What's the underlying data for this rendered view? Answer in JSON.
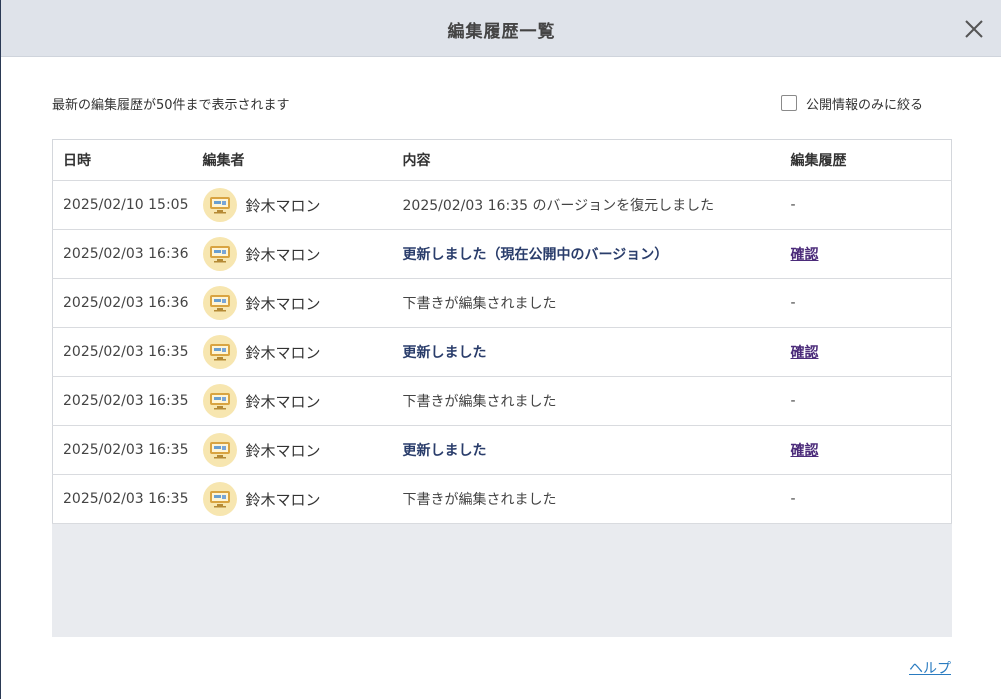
{
  "header": {
    "title": "編集履歴一覧"
  },
  "note": "最新の編集履歴が50件まで表示されます",
  "filter": {
    "label": "公開情報のみに絞る",
    "checked": false
  },
  "table": {
    "columns": [
      "日時",
      "編集者",
      "内容",
      "編集履歴"
    ],
    "rows": [
      {
        "datetime": "2025/02/10 15:05",
        "editor": "鈴木マロン",
        "content": "2025/02/03 16:35 のバージョンを復元しました",
        "history": "-"
      },
      {
        "datetime": "2025/02/03 16:36",
        "editor": "鈴木マロン",
        "content": "更新しました（現在公開中のバージョン）",
        "history": "確認"
      },
      {
        "datetime": "2025/02/03 16:36",
        "editor": "鈴木マロン",
        "content": "下書きが編集されました",
        "history": "-"
      },
      {
        "datetime": "2025/02/03 16:35",
        "editor": "鈴木マロン",
        "content": "更新しました",
        "history": "確認"
      },
      {
        "datetime": "2025/02/03 16:35",
        "editor": "鈴木マロン",
        "content": "下書きが編集されました",
        "history": "-"
      },
      {
        "datetime": "2025/02/03 16:35",
        "editor": "鈴木マロン",
        "content": "更新しました",
        "history": "確認"
      },
      {
        "datetime": "2025/02/03 16:35",
        "editor": "鈴木マロン",
        "content": "下書きが編集されました",
        "history": "-"
      }
    ]
  },
  "footer": {
    "help_label": "ヘルプ"
  },
  "icons": {
    "close": "close-icon",
    "avatar": "computer-avatar-icon"
  },
  "colors": {
    "header_bg": "#dfe3ea",
    "link": "#2a7bc0",
    "visited_link": "#4b2b7a",
    "bold_text": "#2a3d6b",
    "avatar_bg": "#f7e6b0"
  }
}
